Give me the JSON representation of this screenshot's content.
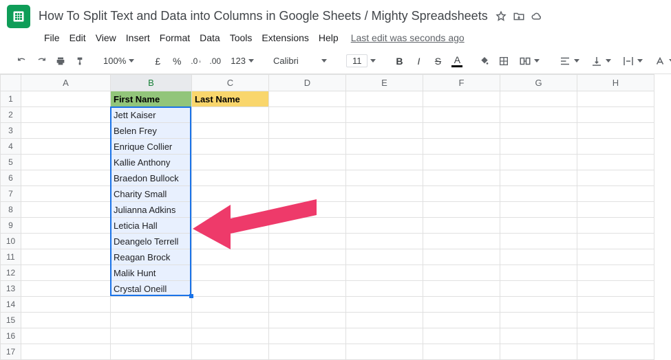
{
  "doc": {
    "title": "How To Split Text and Data into Columns in Google Sheets / Mighty Spreadsheets"
  },
  "menus": {
    "file": "File",
    "edit": "Edit",
    "view": "View",
    "insert": "Insert",
    "format": "Format",
    "data": "Data",
    "tools": "Tools",
    "extensions": "Extensions",
    "help": "Help",
    "last_edit": "Last edit was seconds ago"
  },
  "toolbar": {
    "zoom": "100%",
    "currency": "£",
    "percent": "%",
    "dec_dec": ".0",
    "dec_inc": ".00",
    "more_formats": "123",
    "font": "Calibri",
    "font_size": "11",
    "bold": "B",
    "italic": "I",
    "strike": "S",
    "text_color": "A"
  },
  "columns": [
    "A",
    "B",
    "C",
    "D",
    "E",
    "F",
    "G",
    "H"
  ],
  "rows": [
    1,
    2,
    3,
    4,
    5,
    6,
    7,
    8,
    9,
    10,
    11,
    12,
    13,
    14,
    15,
    16,
    17
  ],
  "headers": {
    "b1": "First Name",
    "c1": "Last Name"
  },
  "names": [
    "Jett Kaiser",
    "Belen Frey",
    "Enrique Collier",
    "Kallie Anthony",
    "Braedon Bullock",
    "Charity Small",
    "Julianna Adkins",
    "Leticia Hall",
    "Deangelo Terrell",
    "Reagan Brock",
    "Malik Hunt",
    "Crystal Oneill"
  ],
  "colors": {
    "accent": "#1a73e8",
    "arrow": "#ee3a6a"
  }
}
